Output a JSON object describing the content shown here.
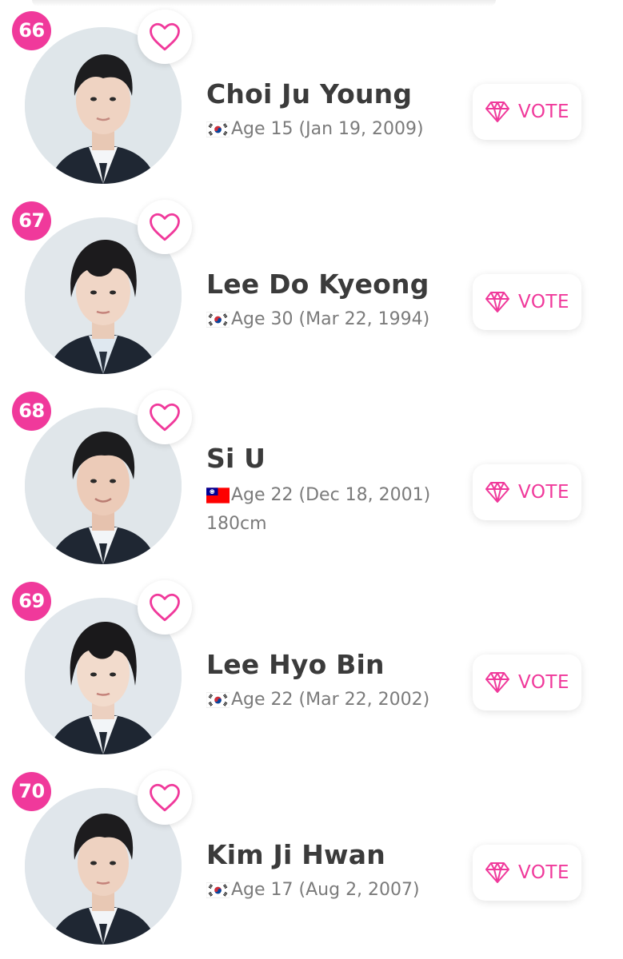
{
  "accent_color": "#f0399b",
  "candidates": [
    {
      "rank": "66",
      "name": "Choi Ju Young",
      "age_text": "Age 15 (Jan 19, 2009)",
      "flag": "korea-flag-icon",
      "height": "",
      "vote_label": "VOTE"
    },
    {
      "rank": "67",
      "name": "Lee Do Kyeong",
      "age_text": "Age 30 (Mar 22, 1994)",
      "flag": "korea-flag-icon",
      "height": "",
      "vote_label": "VOTE"
    },
    {
      "rank": "68",
      "name": "Si U",
      "age_text": "Age 22 (Dec 18, 2001)",
      "flag": "taiwan-flag-icon",
      "height": "180cm",
      "vote_label": "VOTE"
    },
    {
      "rank": "69",
      "name": "Lee Hyo Bin",
      "age_text": "Age 22 (Mar 22, 2002)",
      "flag": "korea-flag-icon",
      "height": "",
      "vote_label": "VOTE"
    },
    {
      "rank": "70",
      "name": "Kim Ji Hwan",
      "age_text": "Age 17 (Aug 2, 2007)",
      "flag": "korea-flag-icon",
      "height": "",
      "vote_label": "VOTE"
    }
  ]
}
